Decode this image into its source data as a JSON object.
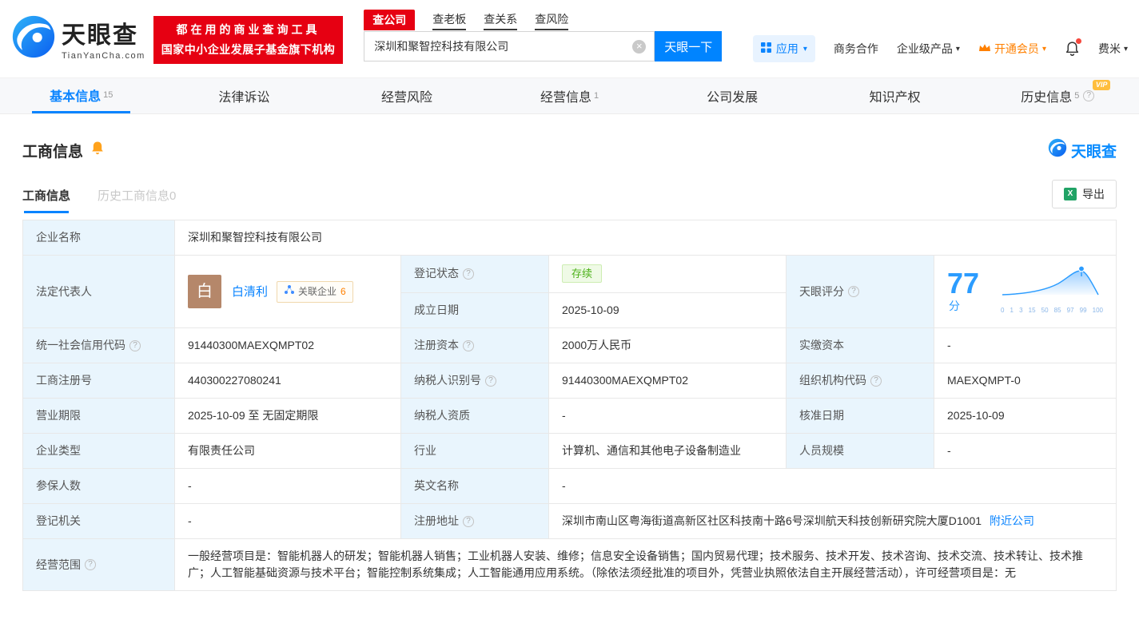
{
  "icons": {
    "caret": "▾",
    "clear": "×",
    "help": "?",
    "excel": "X"
  },
  "header": {
    "logo": {
      "cn": "天眼查",
      "en": "TianYanCha.com"
    },
    "slogan": {
      "line1": "都在用的商业查询工具",
      "line2": "国家中小企业发展子基金旗下机构"
    },
    "search": {
      "tabs": [
        {
          "label": "查公司"
        },
        {
          "label": "查老板"
        },
        {
          "label": "查关系"
        },
        {
          "label": "查风险"
        }
      ],
      "value": "深圳和聚智控科技有限公司",
      "button": "天眼一下"
    },
    "nav": {
      "apps": "应用",
      "cooperation": "商务合作",
      "enterprise": "企业级产品",
      "vip": "开通会员",
      "user": "费米"
    }
  },
  "main_tabs": [
    {
      "label": "基本信息",
      "count": "15"
    },
    {
      "label": "法律诉讼"
    },
    {
      "label": "经营风险"
    },
    {
      "label": "经营信息",
      "count": "1"
    },
    {
      "label": "公司发展"
    },
    {
      "label": "知识产权"
    },
    {
      "label": "历史信息",
      "count": "5",
      "vip_badge": "VIP"
    }
  ],
  "section": {
    "title": "工商信息",
    "brand": "天眼查",
    "subtabs": [
      {
        "label": "工商信息"
      },
      {
        "label": "历史工商信息0"
      }
    ],
    "export": "导出"
  },
  "legal": {
    "label": "法定代表人",
    "avatar": "白",
    "name": "白清利",
    "related_label": "关联企业",
    "related_count": "6"
  },
  "score": {
    "label": "天眼评分",
    "value": "77",
    "unit": "分",
    "axis": [
      "0",
      "1",
      "3",
      "15",
      "50",
      "85",
      "97",
      "99",
      "100"
    ]
  },
  "fields": {
    "company_name": {
      "label": "企业名称",
      "value": "深圳和聚智控科技有限公司"
    },
    "reg_status": {
      "label": "登记状态",
      "value": "存续"
    },
    "establish_date": {
      "label": "成立日期",
      "value": "2025-10-09"
    },
    "credit_code": {
      "label": "统一社会信用代码",
      "value": "91440300MAEXQMPT02"
    },
    "reg_capital": {
      "label": "注册资本",
      "value": "2000万人民币"
    },
    "paid_capital": {
      "label": "实缴资本",
      "value": "-"
    },
    "reg_number": {
      "label": "工商注册号",
      "value": "440300227080241"
    },
    "taxpayer_id": {
      "label": "纳税人识别号",
      "value": "91440300MAEXQMPT02"
    },
    "org_code": {
      "label": "组织机构代码",
      "value": "MAEXQMPT-0"
    },
    "business_term": {
      "label": "营业期限",
      "value": "2025-10-09 至 无固定期限"
    },
    "taxpayer_quality": {
      "label": "纳税人资质",
      "value": "-"
    },
    "approval_date": {
      "label": "核准日期",
      "value": "2025-10-09"
    },
    "company_type": {
      "label": "企业类型",
      "value": "有限责任公司"
    },
    "industry": {
      "label": "行业",
      "value": "计算机、通信和其他电子设备制造业"
    },
    "staff_size": {
      "label": "人员规模",
      "value": "-"
    },
    "insured_count": {
      "label": "参保人数",
      "value": "-"
    },
    "english_name": {
      "label": "英文名称",
      "value": "-"
    },
    "reg_authority": {
      "label": "登记机关",
      "value": "-"
    },
    "reg_address": {
      "label": "注册地址",
      "value": "深圳市南山区粤海街道高新区社区科技南十路6号深圳航天科技创新研究院大厦D1001",
      "link": "附近公司"
    },
    "business_scope": {
      "label": "经营范围",
      "value": "一般经营项目是：智能机器人的研发；智能机器人销售；工业机器人安装、维修；信息安全设备销售；国内贸易代理；技术服务、技术开发、技术咨询、技术交流、技术转让、技术推广；人工智能基础资源与技术平台；智能控制系统集成；人工智能通用应用系统。（除依法须经批准的项目外，凭营业执照依法自主开展经营活动），许可经营项目是：无"
    }
  }
}
